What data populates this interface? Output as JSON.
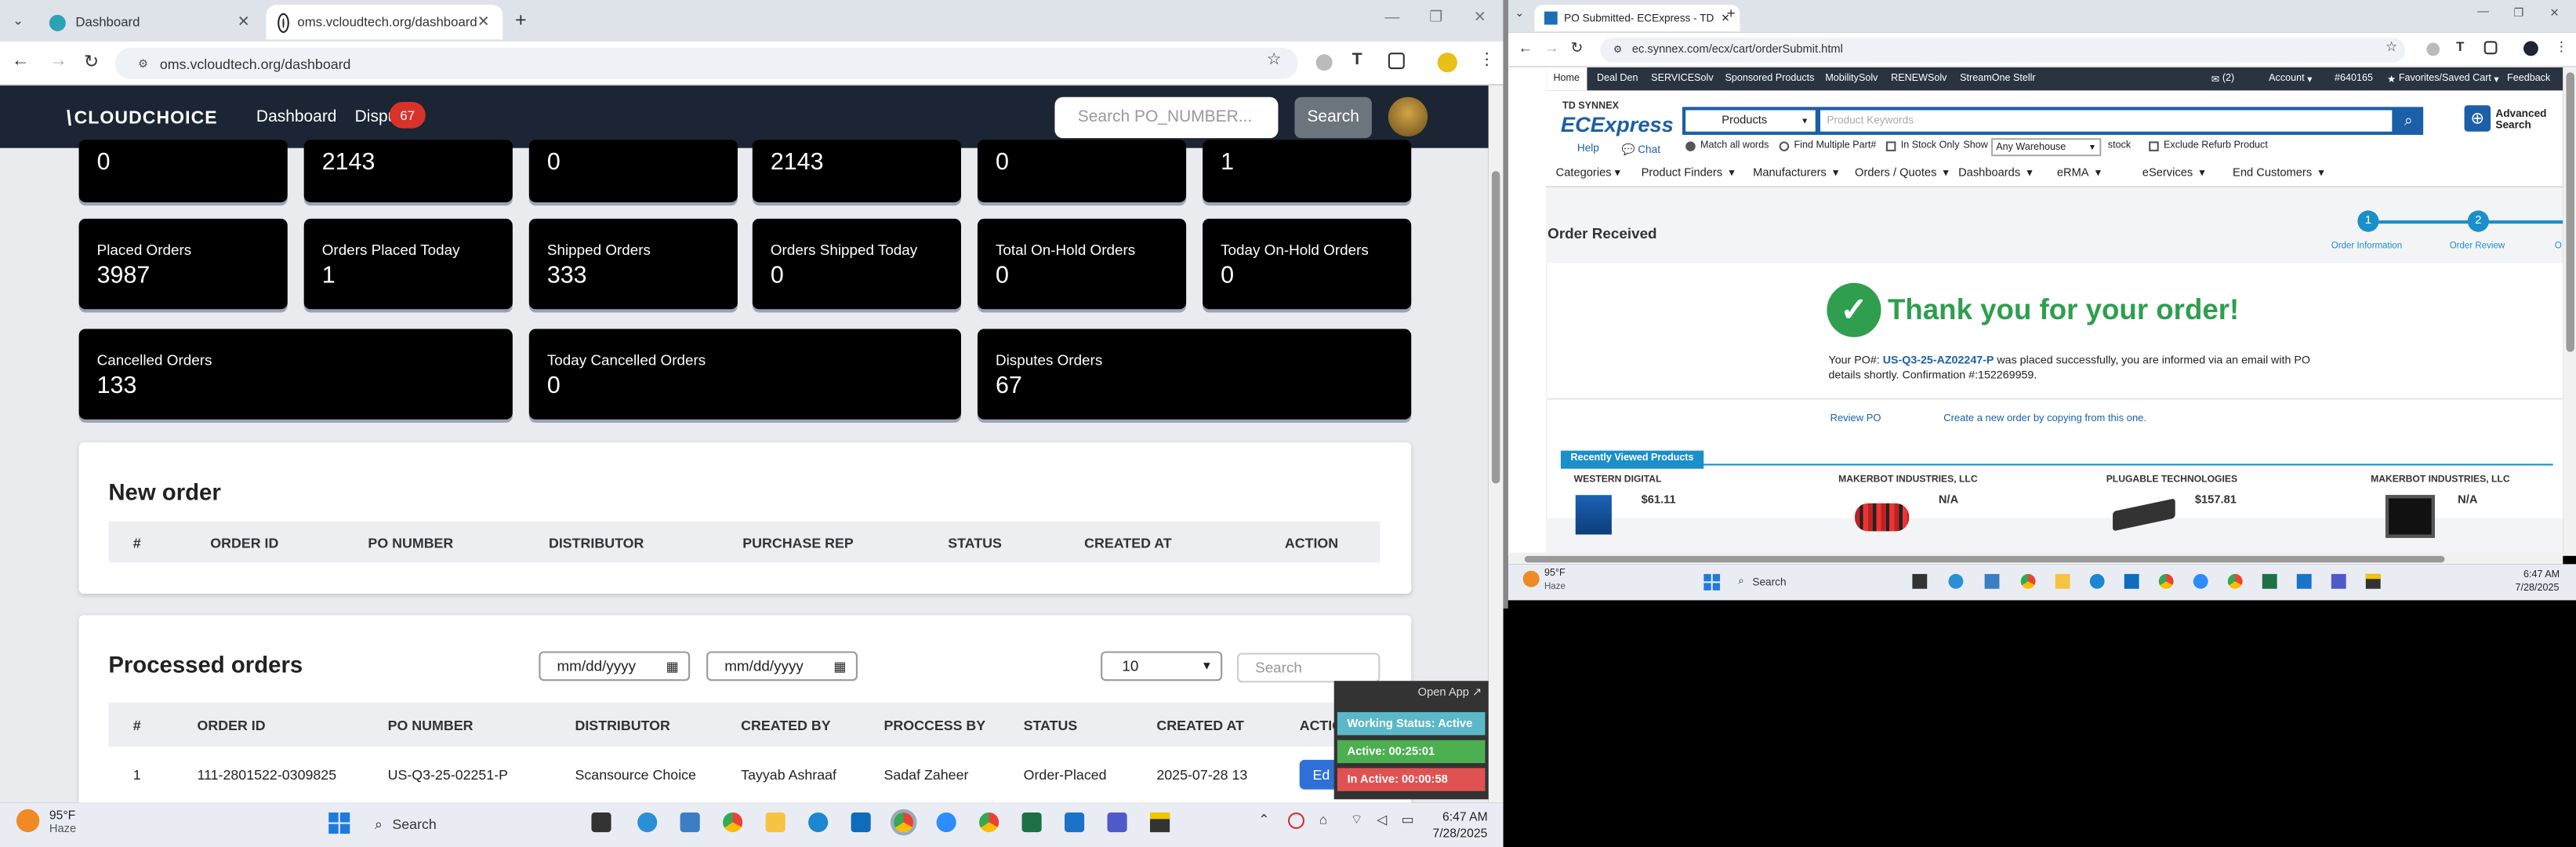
{
  "left_window": {
    "tabs": [
      {
        "title": "Dashboard",
        "active": false
      },
      {
        "title": "oms.vcloudtech.org/dashboard",
        "active": true
      }
    ],
    "url": "oms.vcloudtech.org/dashboard",
    "nav": {
      "logo": "CLOUDCHOICE",
      "links": [
        "Dashboard",
        "Dispu"
      ],
      "disputes_badge": "67",
      "search_placeholder": "Search PO_NUMBER...",
      "search_button": "Search"
    },
    "top_partial_values": [
      "0",
      "2143",
      "0",
      "2143",
      "0",
      "1"
    ],
    "stat_cards_row2": [
      {
        "label": "Placed Orders",
        "value": "3987"
      },
      {
        "label": "Orders Placed Today",
        "value": "1"
      },
      {
        "label": "Shipped Orders",
        "value": "333"
      },
      {
        "label": "Orders Shipped Today",
        "value": "0"
      },
      {
        "label": "Total On-Hold Orders",
        "value": "0"
      },
      {
        "label": "Today On-Hold Orders",
        "value": "0"
      }
    ],
    "stat_cards_row3": [
      {
        "label": "Cancelled Orders",
        "value": "133"
      },
      {
        "label": "Today Cancelled Orders",
        "value": "0"
      },
      {
        "label": "Disputes Orders",
        "value": "67"
      }
    ],
    "new_order": {
      "title": "New order",
      "columns": [
        "#",
        "ORDER ID",
        "PO NUMBER",
        "DISTRIBUTOR",
        "PURCHASE REP",
        "STATUS",
        "CREATED AT",
        "ACTION"
      ]
    },
    "processed_orders": {
      "title": "Processed orders",
      "date_from": "mm/dd/yyyy",
      "date_to": "mm/dd/yyyy",
      "page_size": "10",
      "search_placeholder": "Search",
      "columns": [
        "#",
        "ORDER ID",
        "PO NUMBER",
        "DISTRIBUTOR",
        "CREATED BY",
        "PROCCESS BY",
        "STATUS",
        "CREATED AT",
        "ACTION"
      ],
      "rows": [
        {
          "num": "1",
          "order_id": "111-2801522-0309825",
          "po_number": "US-Q3-25-02251-P",
          "distributor": "Scansource Choice",
          "created_by": "Tayyab Ashraaf",
          "processed_by": "Sadaf Zaheer",
          "status": "Order-Placed",
          "created_at": "2025-07-28 13",
          "action": "Ed"
        }
      ]
    },
    "widget": {
      "open_app": "Open App ↗",
      "working_status": "Working Status: Active",
      "active_time": "Active: 00:25:01",
      "inactive_time": "In Active: 00:00:58"
    },
    "taskbar": {
      "weather_temp": "95°F",
      "weather_desc": "Haze",
      "search": "Search",
      "time": "6:47 AM",
      "date": "7/28/2025"
    }
  },
  "right_window": {
    "tab_title": "PO Submitted- ECExpress - TD",
    "url": "ec.synnex.com/ecx/cart/orderSubmit.html",
    "menu": [
      "Home",
      "Deal Den",
      "SERVICESolv",
      "Sponsored Products",
      "MobilitySolv",
      "RENEWSolv",
      "StreamOne Stellr"
    ],
    "menu_right": [
      "(2)",
      "Account",
      "#640165",
      "Favorites/Saved Cart",
      "Feedback"
    ],
    "logo_top": "TD SYNNEX",
    "logo_main": "ECExpress",
    "search_category": "Products",
    "search_placeholder": "Product Keywords",
    "advanced_search": [
      "Advanced",
      "Search"
    ],
    "help": "Help",
    "chat": "Chat",
    "options": [
      "Match all words",
      "Find Multiple Part#",
      "In Stock Only",
      "Show",
      "Any Warehouse",
      "stock",
      "Exclude Refurb Product"
    ],
    "categories": [
      "Categories",
      "Product Finders",
      "Manufacturers",
      "Orders / Quotes",
      "Dashboards",
      "eRMA",
      "eServices",
      "End Customers"
    ],
    "order_received": "Order Received",
    "steps": [
      {
        "num": "1",
        "label": "Order Information"
      },
      {
        "num": "2",
        "label": "Order Review"
      },
      {
        "num": "",
        "label": "O"
      }
    ],
    "thank_you": "Thank you for your order!",
    "po_text_pre": "Your PO#:",
    "po_number": "US-Q3-25-AZ02247-P",
    "po_text_post": "was placed successfully, you are informed via an email with PO",
    "po_text_line2": "details shortly. Confirmation #:152269959.",
    "review_po": "Review PO",
    "create_new": "Create a new order by copying from this one.",
    "recently_viewed": "Recently Viewed Products",
    "products": [
      {
        "brand": "WESTERN DIGITAL",
        "price": "$61.11"
      },
      {
        "brand": "MAKERBOT INDUSTRIES, LLC",
        "price": "N/A"
      },
      {
        "brand": "PLUGABLE TECHNOLOGIES",
        "price": "$157.81"
      },
      {
        "brand": "MAKERBOT INDUSTRIES, LLC",
        "price": "N/A"
      }
    ],
    "taskbar": {
      "weather_temp": "95°F",
      "weather_desc": "Haze",
      "search": "Search",
      "time": "6:47 AM",
      "date": "7/28/2025"
    }
  }
}
